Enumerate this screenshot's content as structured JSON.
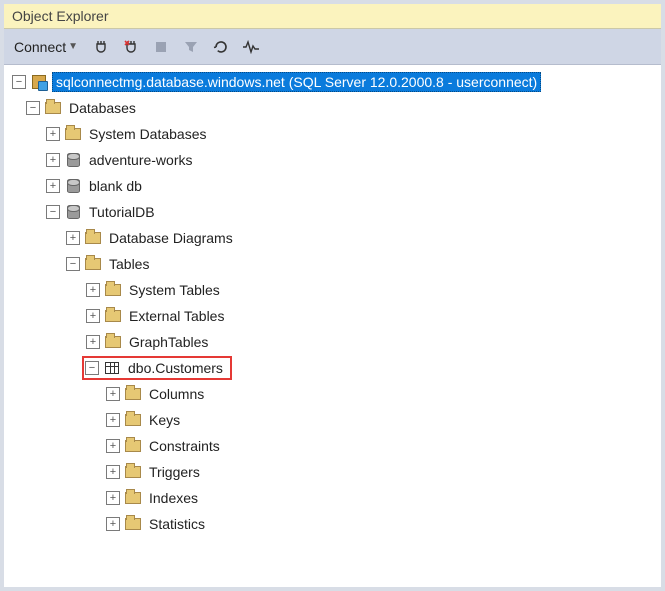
{
  "panel": {
    "title": "Object Explorer"
  },
  "toolbar": {
    "connect_label": "Connect"
  },
  "tree": {
    "server": "sqlconnectmg.database.windows.net (SQL Server 12.0.2000.8 - userconnect)",
    "databases": "Databases",
    "system_databases": "System Databases",
    "adventure_works": "adventure-works",
    "blank_db": "blank db",
    "tutorialdb": "TutorialDB",
    "database_diagrams": "Database Diagrams",
    "tables": "Tables",
    "system_tables": "System Tables",
    "external_tables": "External Tables",
    "graph_tables": "GraphTables",
    "dbo_customers": "dbo.Customers",
    "columns": "Columns",
    "keys": "Keys",
    "constraints": "Constraints",
    "triggers": "Triggers",
    "indexes": "Indexes",
    "statistics": "Statistics"
  }
}
